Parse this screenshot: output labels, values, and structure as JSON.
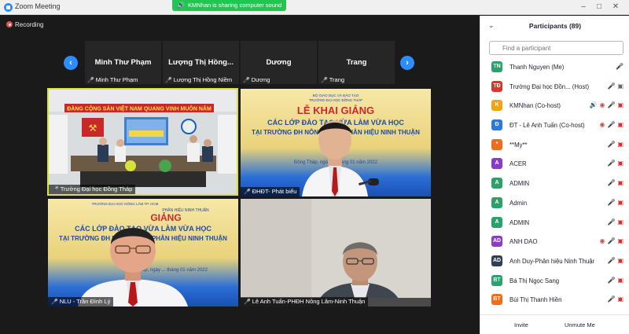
{
  "window": {
    "title": "Zoom Meeting",
    "share_banner": "KMNhan is sharing computer sound"
  },
  "recording": {
    "label": "Recording"
  },
  "strip": [
    {
      "name": "Minh Thư Phạm",
      "label": "Minh Thư Phạm"
    },
    {
      "name": "Lượng Thị Hồng...",
      "label": "Lượng Thị Hồng Niềm"
    },
    {
      "name": "Dương",
      "label": "Dương"
    },
    {
      "name": "Trang",
      "label": "Trang"
    }
  ],
  "gallery": [
    {
      "label": "Trường Đại học Đồng Tháp"
    },
    {
      "label": "ĐHĐT- Phát biểu"
    },
    {
      "label": "NLU - Trần Đình Lý"
    },
    {
      "label": "Lê Anh Tuấn-PHĐH Nông Lâm-Ninh Thuận"
    }
  ],
  "banner": {
    "line1": "ĐẢNG CỘNG SẢN VIỆT NAM QUANG VINH MUÔN NĂM",
    "title_short": "LỄ KHAI GIẢNG",
    "title_tail": "GIẢNG",
    "line2": "CÁC LỚP ĐÀO TẠO VỪA LÀM VỪA HỌC",
    "line3": "TẠI TRƯỜNG ĐH NÔNG LÂM - PHÂN HIỆU NINH THUẬN",
    "date": "Đồng Tháp, ngày ... tháng 01 năm 2022",
    "org": "BỘ GIÁO DỤC VÀ ĐÀO TẠO",
    "school": "TRƯỜNG ĐẠI HỌC ĐỒNG THÁP",
    "branch": "PHÂN HIỆU NINH THUẬN",
    "upper": "TRƯỜNG ĐẠI HỌC NÔNG LÂM TP. HCM"
  },
  "participants": {
    "title": "Participants (89)",
    "search_placeholder": "Find a participant",
    "invite_label": "Invite",
    "unmute_label": "Unmute Me",
    "items": [
      {
        "initials": "TN",
        "name": "Thanh Nguyen (Me)",
        "color": "#2aa36b",
        "icons": [
          "mic-off"
        ]
      },
      {
        "initials": "TĐ",
        "name": "Trường Đại học Đồn... (Host)",
        "color": "#d9362b",
        "icons": [
          "mic-on",
          "cam-on"
        ]
      },
      {
        "initials": "K",
        "name": "KMNhan (Co-host)",
        "color": "#f3a311",
        "icons": [
          "spk",
          "share",
          "mic-off",
          "cam-off"
        ]
      },
      {
        "initials": "Đ",
        "name": "ĐT - Lê Anh Tuấn (Co-host)",
        "color": "#2d7bd6",
        "icons": [
          "share",
          "mic-off",
          "cam-off"
        ]
      },
      {
        "initials": "*",
        "name": "**My**",
        "color": "#ef6d1f",
        "icons": [
          "mic-off",
          "cam-off"
        ]
      },
      {
        "initials": "A",
        "name": "ACER",
        "color": "#8a3cc4",
        "icons": [
          "mic-off",
          "cam-off"
        ]
      },
      {
        "initials": "A",
        "name": "ADMIN",
        "color": "#2aa36b",
        "icons": [
          "mic-off",
          "cam-off"
        ]
      },
      {
        "initials": "A",
        "name": "Admin",
        "color": "#2aa36b",
        "icons": [
          "mic-off",
          "cam-off"
        ]
      },
      {
        "initials": "A",
        "name": "ADMIN",
        "color": "#2aa36b",
        "icons": [
          "mic-off",
          "cam-off"
        ]
      },
      {
        "initials": "AD",
        "name": "ANH DAO",
        "color": "#8a3cc4",
        "icons": [
          "share",
          "mic-off",
          "cam-off"
        ]
      },
      {
        "initials": "AD",
        "name": "Anh Duy-Phân hiệu Ninh Thuận",
        "color": "#2f3e55",
        "icons": [
          "mic-off",
          "cam-off"
        ]
      },
      {
        "initials": "BT",
        "name": "Bá Thị Ngọc Sang",
        "color": "#2aa36b",
        "icons": [
          "mic-off",
          "cam-off"
        ]
      },
      {
        "initials": "BT",
        "name": "Bùi Thị Thanh Hiền",
        "color": "#ef6d1f",
        "icons": [
          "mic-off",
          "cam-off"
        ]
      }
    ]
  }
}
